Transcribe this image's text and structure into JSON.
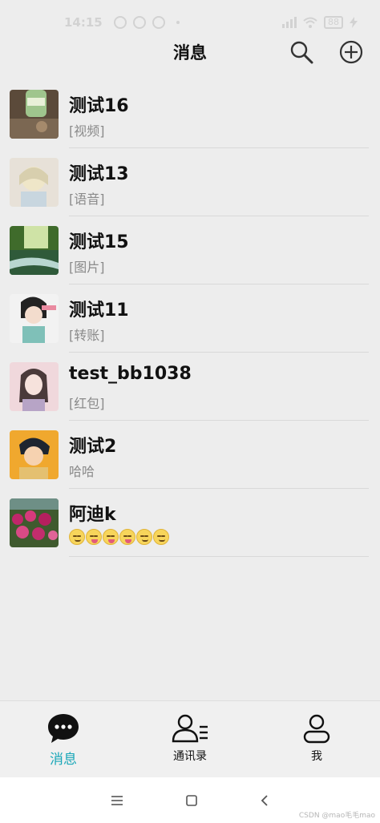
{
  "status_bar": {
    "time": "14:15",
    "battery": "88"
  },
  "header": {
    "title": "消息"
  },
  "conversations": [
    {
      "name": "测试16",
      "preview": "[视频]"
    },
    {
      "name": "测试13",
      "preview": "[语音]"
    },
    {
      "name": "测试15",
      "preview": "[图片]"
    },
    {
      "name": "测试11",
      "preview": "[转账]"
    },
    {
      "name": "test_bb1038",
      "preview": "[红包]"
    },
    {
      "name": "测试2",
      "preview": "哈哈"
    },
    {
      "name": "阿迪k",
      "preview": ""
    }
  ],
  "tabs": [
    {
      "label": "消息",
      "icon": "chat-bubble-icon",
      "active": true
    },
    {
      "label": "通讯录",
      "icon": "contacts-icon",
      "active": false
    },
    {
      "label": "我",
      "icon": "person-icon",
      "active": false
    }
  ],
  "colors": {
    "accent": "#1aa7b8",
    "background": "#ededed"
  },
  "watermark": "CSDN @mao毛毛mao"
}
